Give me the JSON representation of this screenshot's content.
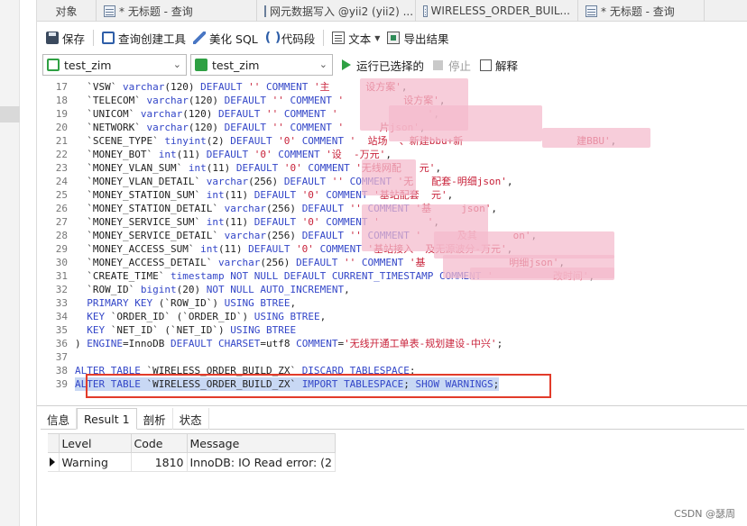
{
  "tabs": [
    {
      "label": "对象"
    },
    {
      "label": "* 无标题 - 查询"
    },
    {
      "label": "网元数据写入 @yii2 (yii2) ..."
    },
    {
      "label": "WIRELESS_ORDER_BUIL..."
    },
    {
      "label": "* 无标题 - 查询"
    }
  ],
  "toolbar": {
    "save": "保存",
    "query_builder": "查询创建工具",
    "beautify_sql": "美化 SQL",
    "code_snippet": "代码段",
    "text": "文本",
    "export_result": "导出结果"
  },
  "selectors": {
    "connection": "test_zim",
    "database": "test_zim",
    "run_selected": "运行已选择的",
    "stop": "停止",
    "explain": "解释"
  },
  "editor": {
    "lines": [
      {
        "no": "17",
        "text": "  `VSW` varchar(120) DEFAULT '' COMMENT '主      设方案',"
      },
      {
        "no": "18",
        "text": "  `TELECOM` varchar(120) DEFAULT '' COMMENT '          设方案',"
      },
      {
        "no": "19",
        "text": "  `UNICOM` varchar(120) DEFAULT '' COMMENT '               ',"
      },
      {
        "no": "20",
        "text": "  `NETWORK` varchar(120) DEFAULT '' COMMENT '      片json',"
      },
      {
        "no": "21",
        "text": "  `SCENE_TYPE` tinyint(2) DEFAULT '0' COMMENT '  站场  、新建bbu+新                   建BBU',"
      },
      {
        "no": "22",
        "text": "  `MONEY_BOT` int(11) DEFAULT '0' COMMENT '设  -万元',"
      },
      {
        "no": "23",
        "text": "  `MONEY_VLAN_SUM` int(11) DEFAULT '0' COMMENT '无线网配   元',"
      },
      {
        "no": "24",
        "text": "  `MONEY_VLAN_DETAIL` varchar(256) DEFAULT '' COMMENT '无   配套-明细json',"
      },
      {
        "no": "25",
        "text": "  `MONEY_STATION_SUM` int(11) DEFAULT '0' COMMENT '基站配套  元',"
      },
      {
        "no": "26",
        "text": "  `MONEY_STATION_DETAIL` varchar(256) DEFAULT '' COMMENT '基     json',"
      },
      {
        "no": "27",
        "text": "  `MONEY_SERVICE_SUM` int(11) DEFAULT '0' COMMENT '        ',"
      },
      {
        "no": "28",
        "text": "  `MONEY_SERVICE_DETAIL` varchar(256) DEFAULT '' COMMENT '      及其      on',"
      },
      {
        "no": "29",
        "text": "  `MONEY_ACCESS_SUM` int(11) DEFAULT '0' COMMENT '基站接入  及无源波分-万元',"
      },
      {
        "no": "30",
        "text": "  `MONEY_ACCESS_DETAIL` varchar(256) DEFAULT '' COMMENT '基              明细json',"
      },
      {
        "no": "31",
        "text": "  `CREATE_TIME` timestamp NOT NULL DEFAULT CURRENT_TIMESTAMP COMMENT '          改时间',"
      },
      {
        "no": "32",
        "text": "  `ROW_ID` bigint(20) NOT NULL AUTO_INCREMENT,"
      },
      {
        "no": "33",
        "text": "  PRIMARY KEY (`ROW_ID`) USING BTREE,"
      },
      {
        "no": "34",
        "text": "  KEY `ORDER_ID` (`ORDER_ID`) USING BTREE,"
      },
      {
        "no": "35",
        "text": "  KEY `NET_ID` (`NET_ID`) USING BTREE"
      },
      {
        "no": "36",
        "text": ") ENGINE=InnoDB DEFAULT CHARSET=utf8 COMMENT='无线开通工单表-规划建设-中兴';"
      },
      {
        "no": "37",
        "text": ""
      },
      {
        "no": "38",
        "text": "ALTER TABLE `WIRELESS_ORDER_BUILD_ZX` DISCARD TABLESPACE;"
      },
      {
        "no": "39",
        "text": "ALTER TABLE `WIRELESS_ORDER_BUILD_ZX` IMPORT TABLESPACE; SHOW WARNINGS;"
      }
    ]
  },
  "results": {
    "tabs": [
      {
        "label": "信息"
      },
      {
        "label": "Result 1"
      },
      {
        "label": "剖析"
      },
      {
        "label": "状态"
      }
    ],
    "columns": [
      "Level",
      "Code",
      "Message"
    ],
    "rows": [
      {
        "level": "Warning",
        "code": "1810",
        "message": "InnoDB: IO Read error: (2"
      }
    ]
  },
  "watermark": "CSDN @瑟周",
  "colors": {
    "keyword": "#3346c8",
    "string": "#c8223a",
    "highlight_border": "#e23b2a",
    "selection": "#c8d8f4",
    "run_green": "#2ea043"
  }
}
